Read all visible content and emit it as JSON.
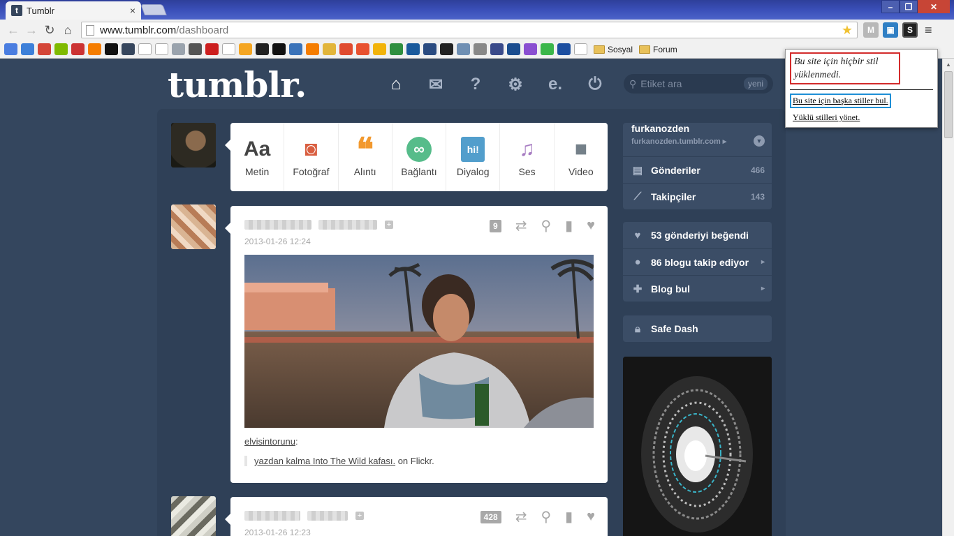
{
  "browser": {
    "tab_title": "Tumblr",
    "tab_close": "×",
    "favicon_letter": "t",
    "url_domain": "www.tumblr.com",
    "url_path": "/dashboard",
    "bookmark_folders": [
      "Sosyal",
      "Forum"
    ]
  },
  "header": {
    "logo": "tumblr.",
    "search_placeholder": "Etiket ara",
    "search_badge": "yeni",
    "nav_icons": [
      "home-icon",
      "mail-icon",
      "help-icon",
      "gear-icon",
      "e-icon",
      "power-icon"
    ]
  },
  "post_types": [
    {
      "label": "Metin",
      "glyph": "Aa",
      "color": "#444444"
    },
    {
      "label": "Fotoğraf",
      "glyph": "◙",
      "color": "#d95e40"
    },
    {
      "label": "Alıntı",
      "glyph": "❝",
      "color": "#f2992e"
    },
    {
      "label": "Bağlantı",
      "glyph": "∞",
      "color": "#56bc8a"
    },
    {
      "label": "Diyalog",
      "glyph": "hi!",
      "color": "#529ecc"
    },
    {
      "label": "Ses",
      "glyph": "♫",
      "color": "#a77dc2"
    },
    {
      "label": "Video",
      "glyph": "■",
      "color": "#748089"
    }
  ],
  "posts": [
    {
      "date": "2013-01-26 12:24",
      "notes": "9",
      "caption_user": "elvisintorunu",
      "caption_colon": ":",
      "quote_link": "yazdan kalma Into The Wild kafası.",
      "quote_rest": " on Flickr."
    },
    {
      "date": "2013-01-26 12:23",
      "notes": "428"
    }
  ],
  "sidebar": {
    "username": "furkanozden",
    "blog_url": "furkanozden.tumblr.com ▸",
    "posts_label": "Gönderiler",
    "posts_count": "466",
    "followers_label": "Takipçiler",
    "followers_count": "143",
    "likes_label": "53 gönderiyi beğendi",
    "following_label": "86 blogu takip ediyor",
    "find_blogs_label": "Blog bul",
    "safe_dash_label": "Safe Dash"
  },
  "popup": {
    "notice": "Bu site için hiçbir stil yüklenmedi.",
    "find_styles": "Bu site için başka stiller bul.",
    "manage_styles": "Yüklü stilleri yönet."
  },
  "colors": {
    "page_bg": "#34465e",
    "accent": "#36465d"
  }
}
